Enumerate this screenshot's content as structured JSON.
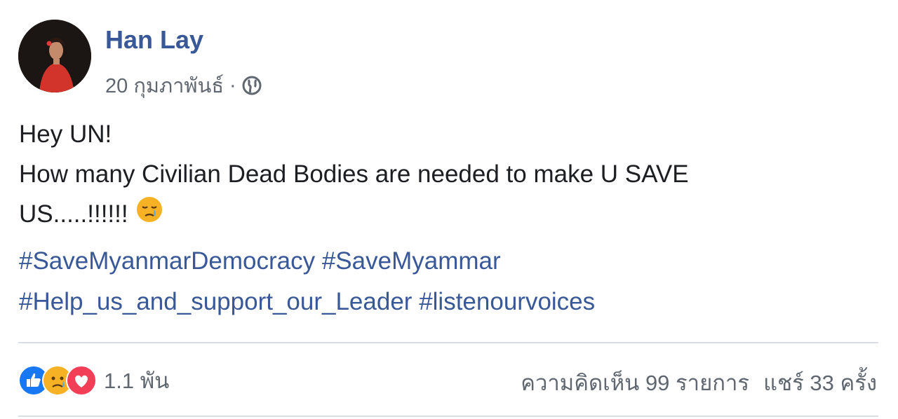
{
  "post": {
    "author": "Han Lay",
    "date": "20 กุมภาพันธ์",
    "separator": "·",
    "privacy_icon": "globe-icon",
    "lines": [
      "Hey UN!",
      "How many Civilian Dead Bodies are needed to make U SAVE",
      "US.....!!!!!!"
    ],
    "inline_emoji": "crying-face-icon",
    "hashtags_line1": [
      "#SaveMyanmarDemocracy",
      "#SaveMyammar"
    ],
    "hashtags_line2": [
      "#Help_us_and_support_our_Leader",
      "#listenourvoices"
    ]
  },
  "footer": {
    "reaction_icons": [
      "like-icon",
      "sad-icon",
      "love-icon"
    ],
    "reaction_count": "1.1 พัน",
    "comments": "ความคิดเห็น 99 รายการ",
    "shares": "แชร์ 33 ครั้ง"
  },
  "colors": {
    "link": "#385898",
    "secondary_text": "#606770",
    "divider": "#dadde1",
    "like_blue": "#1877f2",
    "love_red": "#f33e58",
    "sad_yellow": "#f7b125"
  }
}
